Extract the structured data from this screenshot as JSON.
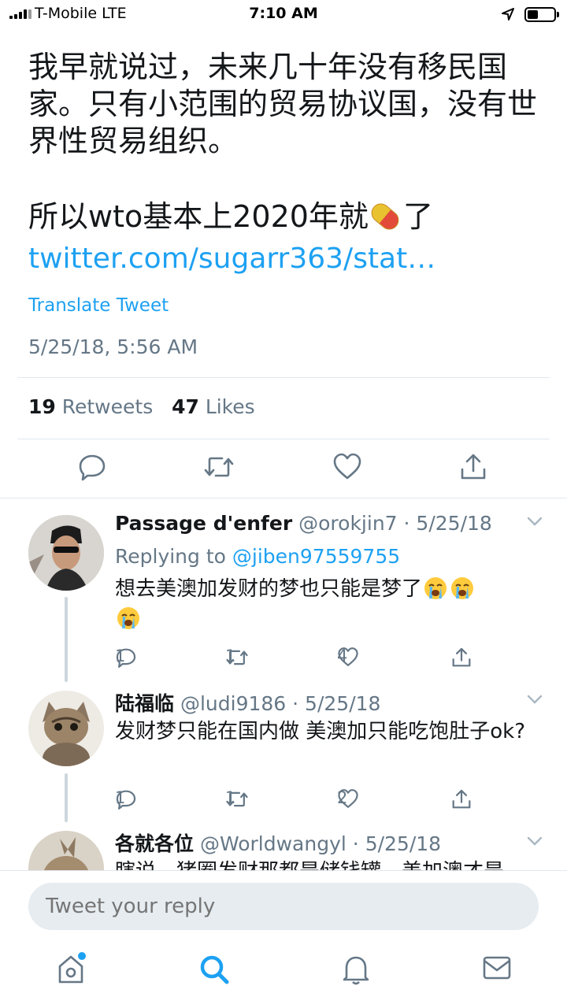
{
  "status_bar": {
    "carrier": "T-Mobile   LTE",
    "time": "7:10 AM"
  },
  "tweet": {
    "text_line1": "我早就说过，未来几十年没有移民国家。只有小范围的贸易协议国，没有世界性贸易组织。",
    "text_line2_before": "所以wto基本上2020年就",
    "text_line2_after": "了",
    "emoji": "pill",
    "link": "twitter.com/sugarr363/stat…",
    "translate": "Translate Tweet",
    "timestamp": "5/25/18, 5:56 AM",
    "retweets_count": "19",
    "retweets_label": "Retweets",
    "likes_count": "47",
    "likes_label": "Likes"
  },
  "replies": [
    {
      "name": "Passage d'enfer",
      "handle": "@orokjin7",
      "date": "· 5/25/18",
      "replying_label": "Replying to",
      "replying_handle": "@jiben97559755",
      "body": "想去美澳加发财的梦也只能是梦了",
      "emojis": [
        "loudly-crying-face",
        "loudly-crying-face",
        "loudly-crying-face"
      ],
      "reply_count": "1",
      "retweet_count": "1",
      "like_count": "4"
    },
    {
      "name": "陆福临",
      "handle": "@ludi9186",
      "date": "· 5/25/18",
      "body": "发财梦只能在国内做 美澳加只能吃饱肚子ok?",
      "reply_count": "1",
      "retweet_count": "1",
      "like_count": "2"
    },
    {
      "name": "各就各位",
      "handle": "@Worldwangyl",
      "date": "· 5/25/18",
      "body": "瞎说，猪圈发财那都是储钱罐，美加澳才是"
    }
  ],
  "composer": {
    "placeholder": "Tweet your reply"
  },
  "colors": {
    "accent": "#1da1f2",
    "secondary_text": "#657786",
    "divider": "#e1e8ed"
  }
}
